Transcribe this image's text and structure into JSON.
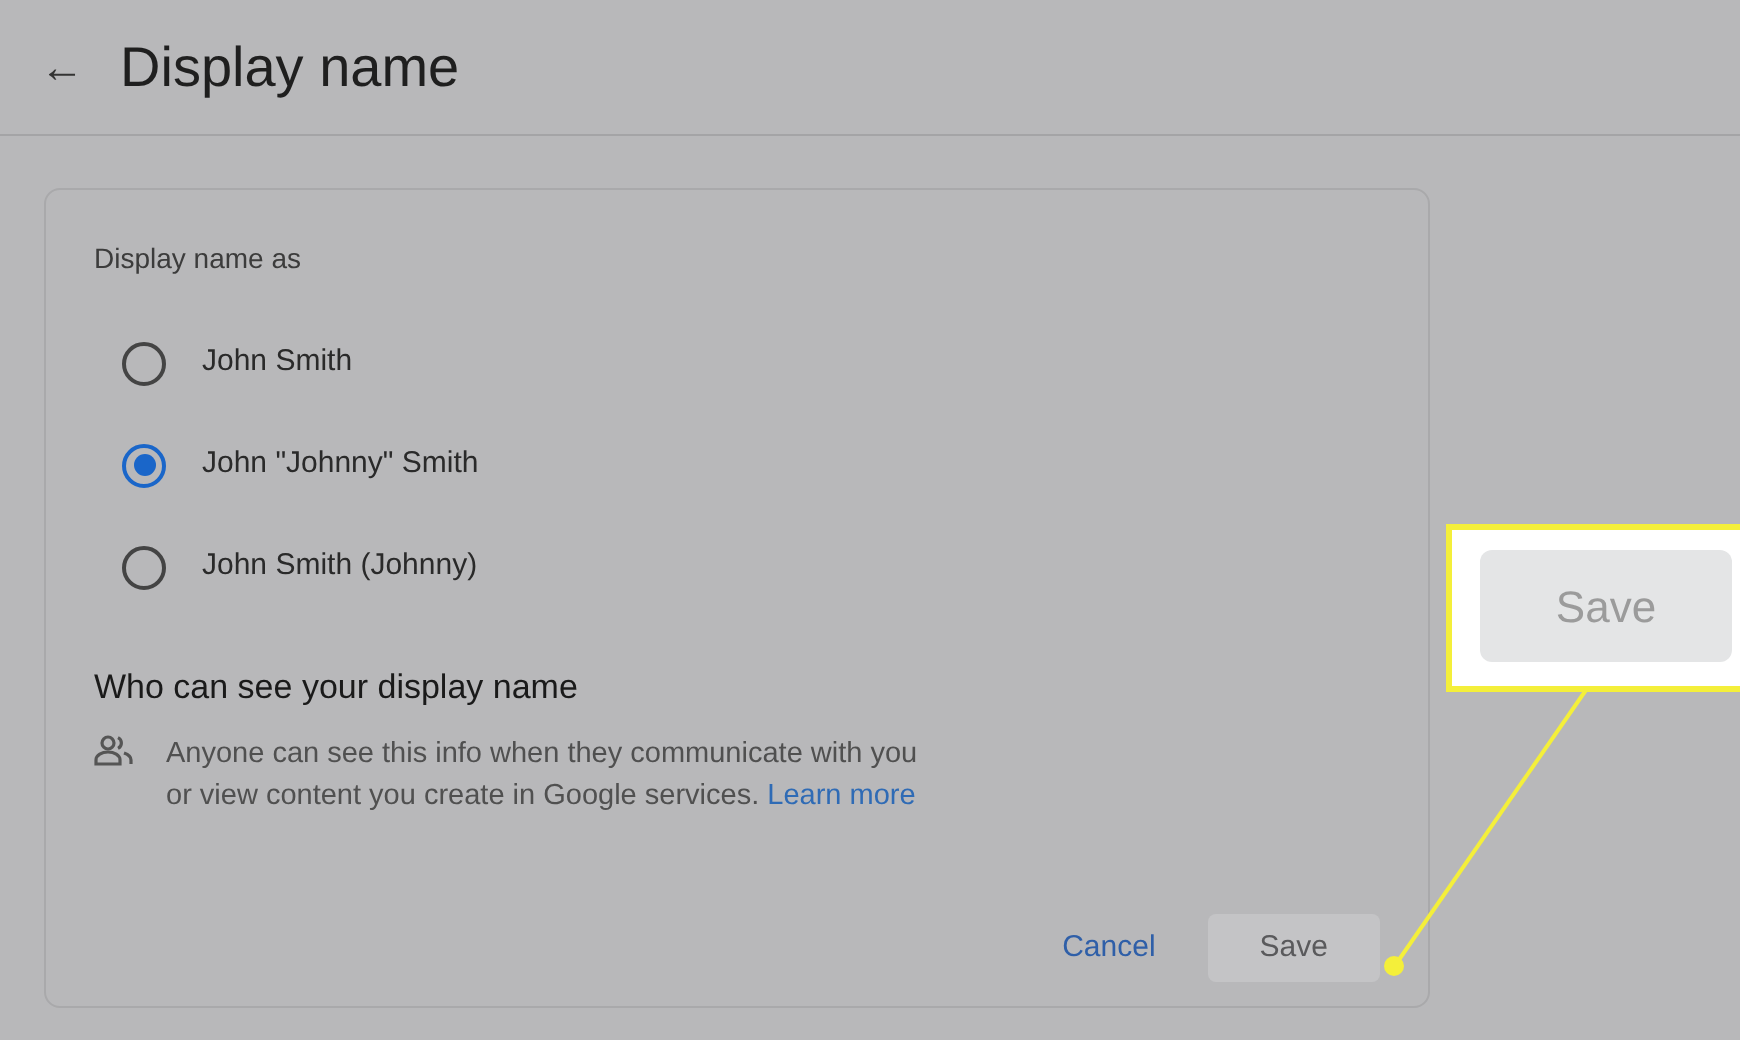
{
  "header": {
    "back": "←",
    "title": "Display name"
  },
  "card": {
    "label": "Display name as",
    "options": [
      {
        "label": "John Smith",
        "selected": false
      },
      {
        "label": "John \"Johnny\" Smith",
        "selected": true
      },
      {
        "label": "John Smith (Johnny)",
        "selected": false
      }
    ],
    "section_title": "Who can see your display name",
    "info": "Anyone can see this info when they communicate with you or view content you create in Google services.",
    "link": "Learn more",
    "buttons": [
      {
        "label": "Cancel",
        "kind": "text"
      },
      {
        "label": "Save",
        "kind": "filled",
        "disabled": true
      }
    ]
  },
  "callout": {
    "label": "Save",
    "disabled": true
  }
}
